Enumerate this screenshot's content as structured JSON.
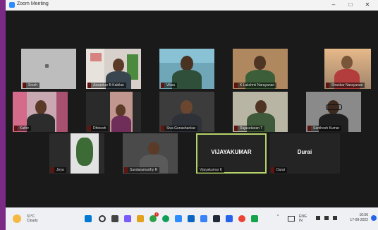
{
  "window": {
    "title": "Zoom Meeting",
    "minimize": "–",
    "maximize": "□",
    "close": "✕"
  },
  "participants": [
    {
      "name": "Sresh"
    },
    {
      "name": "Aasankar B Kabilan"
    },
    {
      "name": "Vikas"
    },
    {
      "name": "K Lakshmi Narayanan"
    },
    {
      "name": "Shankar Narayanan"
    },
    {
      "name": "Kathir"
    },
    {
      "name": "Dhinesh"
    },
    {
      "name": "Siva Gunashankar"
    },
    {
      "name": "Rajasekaran T"
    },
    {
      "name": "Santhosh Kumar"
    },
    {
      "name": "Jeya"
    },
    {
      "name": "Sundaramurthy R"
    },
    {
      "name": "VIJAYAKUMAR",
      "label": "Vijayakumar K"
    },
    {
      "name": "Durai",
      "label": "Durai"
    }
  ],
  "taskbar": {
    "weather_temp": "31°C",
    "weather_desc": "Cloudy",
    "language": "ENG",
    "region": "IN",
    "time": "10:56",
    "date": "17-09-2022",
    "notification_count": "2"
  }
}
